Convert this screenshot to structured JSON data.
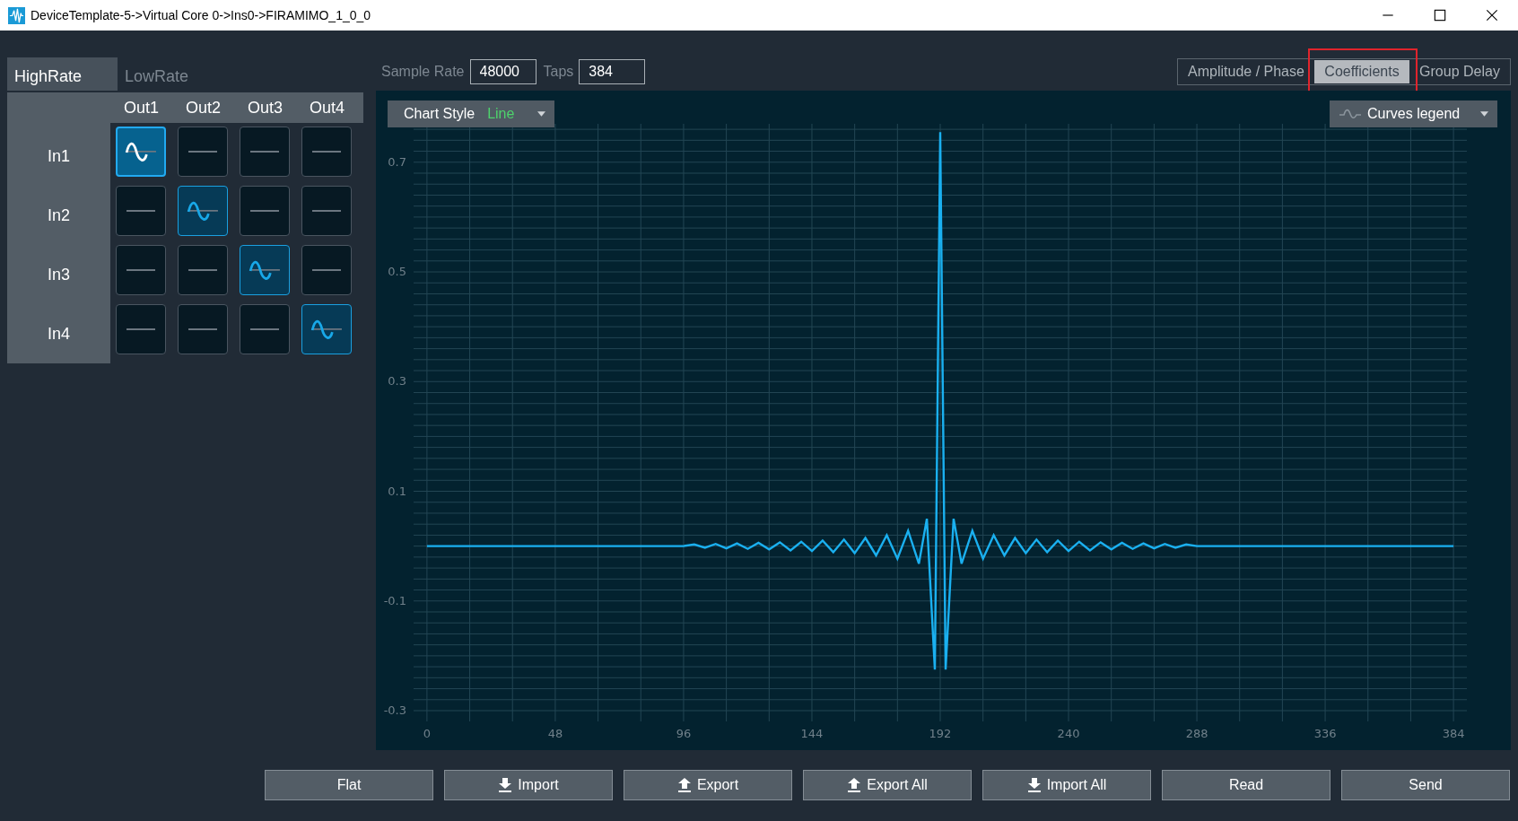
{
  "window": {
    "title": "DeviceTemplate-5->Virtual Core 0->Ins0->FIRAMIMO_1_0_0"
  },
  "rate_tabs": [
    {
      "label": "HighRate",
      "selected": true
    },
    {
      "label": "LowRate",
      "selected": false
    }
  ],
  "matrix": {
    "columns": [
      "Out1",
      "Out2",
      "Out3",
      "Out4"
    ],
    "rows": [
      {
        "label": "In1",
        "cells": [
          {
            "active": true,
            "selected": true
          },
          {
            "active": false,
            "selected": false
          },
          {
            "active": false,
            "selected": false
          },
          {
            "active": false,
            "selected": false
          }
        ]
      },
      {
        "label": "In2",
        "cells": [
          {
            "active": false,
            "selected": false
          },
          {
            "active": true,
            "selected": false
          },
          {
            "active": false,
            "selected": false
          },
          {
            "active": false,
            "selected": false
          }
        ]
      },
      {
        "label": "In3",
        "cells": [
          {
            "active": false,
            "selected": false
          },
          {
            "active": false,
            "selected": false
          },
          {
            "active": true,
            "selected": false
          },
          {
            "active": false,
            "selected": false
          }
        ]
      },
      {
        "label": "In4",
        "cells": [
          {
            "active": false,
            "selected": false
          },
          {
            "active": false,
            "selected": false
          },
          {
            "active": false,
            "selected": false
          },
          {
            "active": true,
            "selected": false
          }
        ]
      }
    ]
  },
  "sample_rate": {
    "label": "Sample Rate",
    "value": "48000"
  },
  "taps": {
    "label": "Taps",
    "value": "384"
  },
  "view_tabs": [
    {
      "label": "Amplitude / Phase",
      "selected": false
    },
    {
      "label": "Coefficients",
      "selected": true
    },
    {
      "label": "Group Delay",
      "selected": false
    }
  ],
  "chart_style": {
    "label": "Chart Style",
    "value": "Line"
  },
  "curves_legend": {
    "label": "Curves legend"
  },
  "chart_data": {
    "type": "line",
    "grid": true,
    "xlim": [
      -5,
      389
    ],
    "ylim": [
      -0.3,
      0.77
    ],
    "xticks": [
      0,
      48,
      96,
      144,
      192,
      240,
      288,
      336,
      384
    ],
    "yticks": [
      0.7,
      0.5,
      0.3,
      0.1,
      -0.1,
      -0.3
    ],
    "x": [
      0,
      96,
      100,
      104,
      108,
      112,
      116,
      120,
      124,
      128,
      132,
      136,
      140,
      144,
      148,
      152,
      156,
      160,
      164,
      168,
      172,
      176,
      180,
      184,
      187,
      190,
      192,
      194,
      197,
      200,
      204,
      208,
      212,
      216,
      220,
      224,
      228,
      232,
      236,
      240,
      244,
      248,
      252,
      256,
      260,
      264,
      268,
      272,
      276,
      280,
      284,
      288,
      384
    ],
    "series": [
      {
        "color": "#1ab0f0",
        "values": [
          0,
          0,
          0.003,
          -0.003,
          0.004,
          -0.004,
          0.005,
          -0.005,
          0.006,
          -0.006,
          0.007,
          -0.008,
          0.008,
          -0.009,
          0.01,
          -0.011,
          0.012,
          -0.013,
          0.015,
          -0.017,
          0.02,
          -0.023,
          0.028,
          -0.032,
          0.05,
          -0.225,
          0.755,
          -0.225,
          0.05,
          -0.032,
          0.028,
          -0.023,
          0.02,
          -0.017,
          0.015,
          -0.013,
          0.012,
          -0.011,
          0.01,
          -0.009,
          0.008,
          -0.008,
          0.007,
          -0.006,
          0.006,
          -0.005,
          0.005,
          -0.004,
          0.004,
          -0.003,
          0.003,
          0,
          0
        ]
      }
    ]
  },
  "buttons": [
    {
      "label": "Flat",
      "kind": "plain"
    },
    {
      "label": "Import",
      "kind": "download"
    },
    {
      "label": "Export",
      "kind": "upload"
    },
    {
      "label": "Export All",
      "kind": "upload"
    },
    {
      "label": "Import All",
      "kind": "download"
    },
    {
      "label": "Read",
      "kind": "plain"
    },
    {
      "label": "Send",
      "kind": "plain"
    }
  ]
}
